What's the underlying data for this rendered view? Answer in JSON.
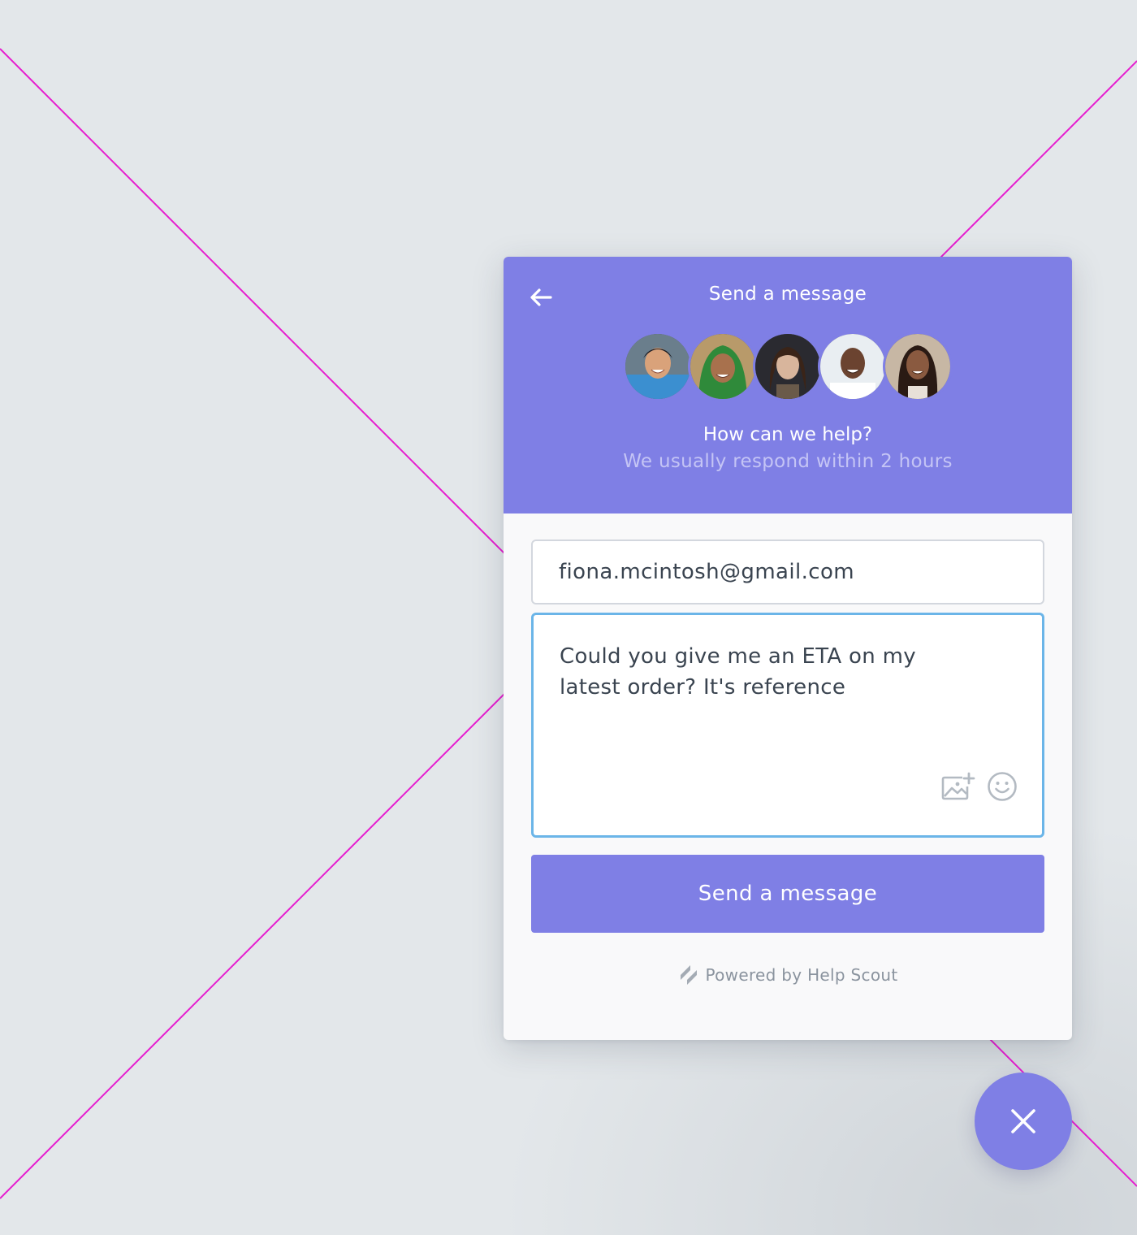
{
  "header": {
    "title": "Send a message",
    "help_title": "How can we help?",
    "help_subtitle": "We usually respond within 2 hours"
  },
  "avatars": [
    {
      "name": "avatar-1"
    },
    {
      "name": "avatar-2"
    },
    {
      "name": "avatar-3"
    },
    {
      "name": "avatar-4"
    },
    {
      "name": "avatar-5"
    }
  ],
  "form": {
    "email_value": "fiona.mcintosh@gmail.com",
    "message_value": "Could you give me an ETA on my latest order? It's reference",
    "submit_label": "Send a message"
  },
  "footer": {
    "powered_by": "Powered by Help Scout"
  },
  "colors": {
    "brand": "#7f7fe5",
    "focus_border": "#6bb5e8",
    "guide_lines": "#e61ccf"
  },
  "icons": [
    "back-arrow-icon",
    "add-image-icon",
    "emoji-icon",
    "help-scout-logo-icon",
    "close-icon"
  ]
}
